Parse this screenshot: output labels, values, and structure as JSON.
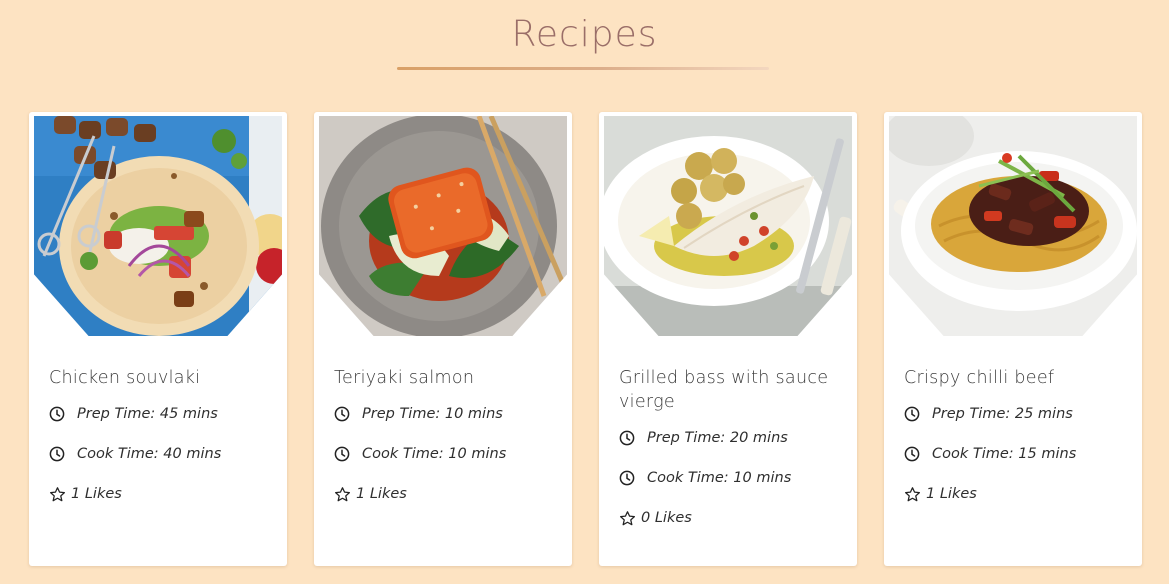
{
  "page": {
    "title": "Recipes"
  },
  "recipes": [
    {
      "name": "Chicken souvlaki",
      "prep_time": "Prep Time: 45 mins",
      "cook_time": "Cook Time: 40 mins",
      "likes": "1 Likes",
      "image": "chicken-souvlaki-photo"
    },
    {
      "name": "Teriyaki salmon",
      "prep_time": "Prep Time: 10 mins",
      "cook_time": "Cook Time: 10 mins",
      "likes": "1 Likes",
      "image": "teriyaki-salmon-photo"
    },
    {
      "name": "Grilled bass with sauce vierge",
      "prep_time": "Prep Time: 20 mins",
      "cook_time": "Cook Time: 10 mins",
      "likes": "0 Likes",
      "image": "grilled-bass-photo"
    },
    {
      "name": "Crispy chilli beef",
      "prep_time": "Prep Time: 25 mins",
      "cook_time": "Cook Time: 15 mins",
      "likes": "1 Likes",
      "image": "crispy-chilli-beef-photo"
    }
  ],
  "icons": {
    "prep": "clock-icon",
    "cook": "clock-icon",
    "likes": "star-icon"
  },
  "colors": {
    "background": "#fde3c2",
    "title": "#9a6e68",
    "card": "#ffffff"
  }
}
